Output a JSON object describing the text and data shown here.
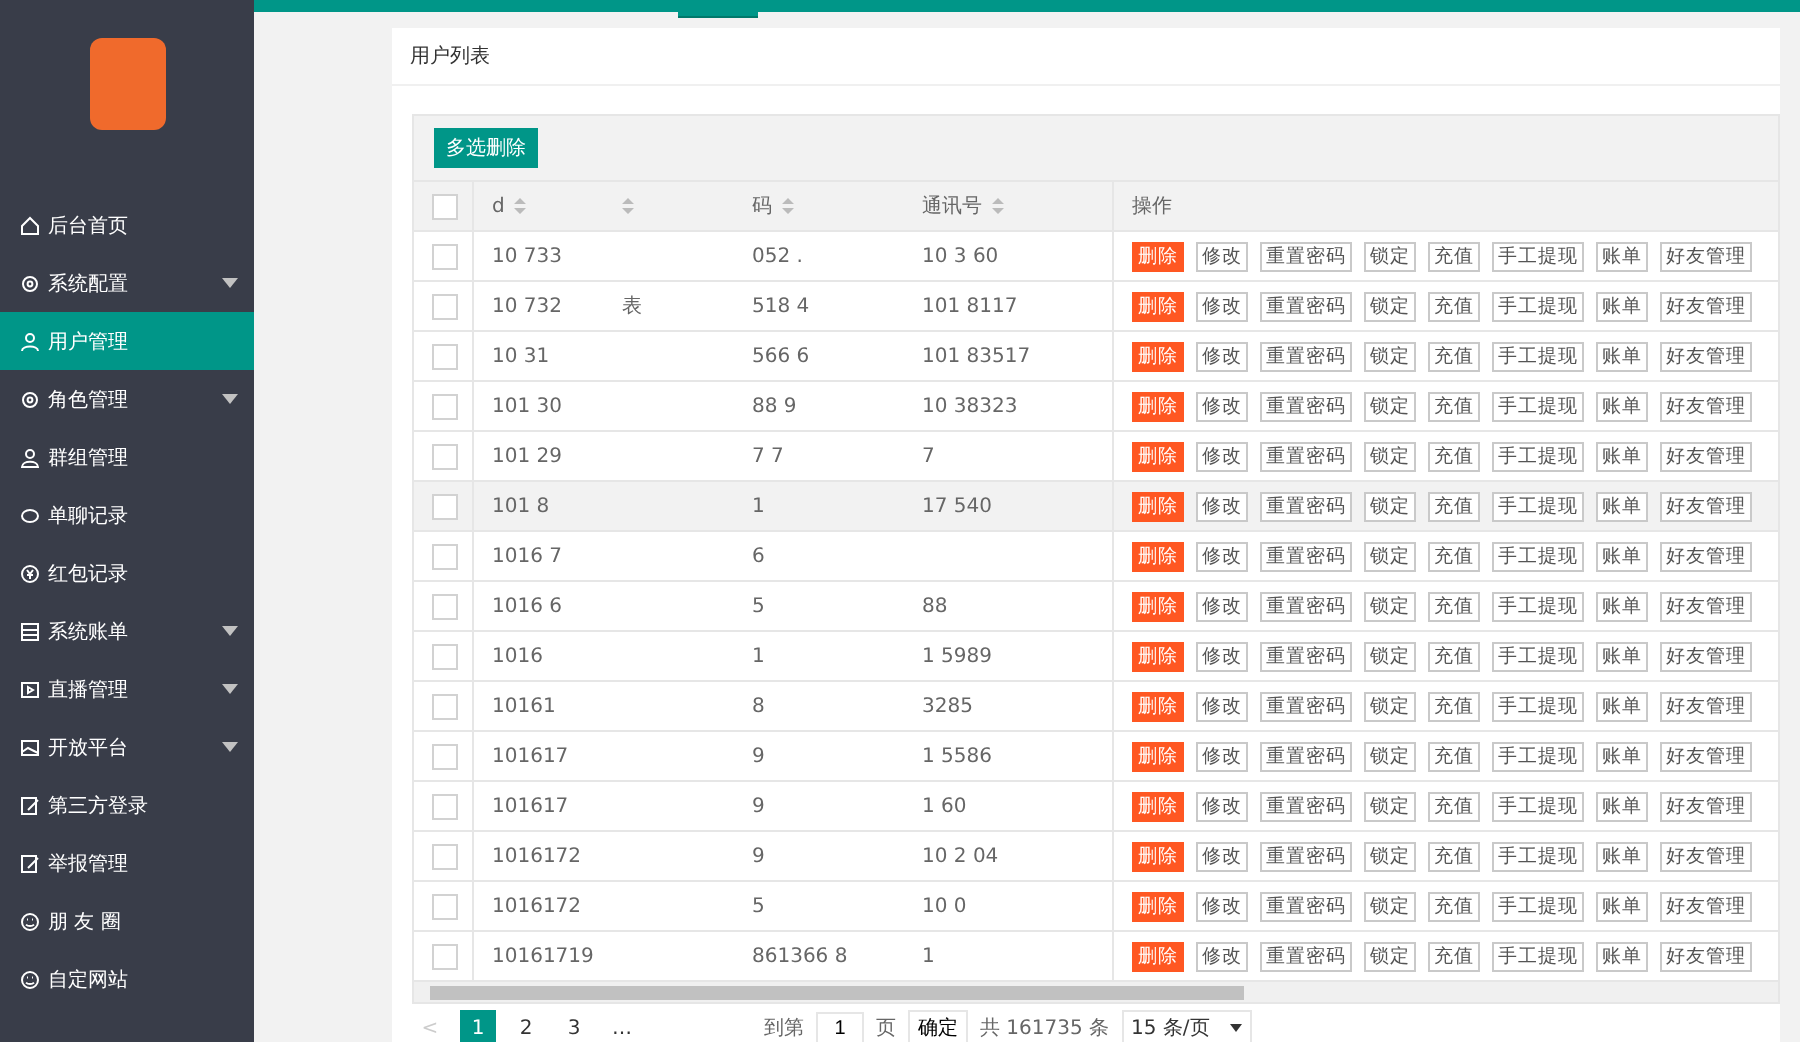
{
  "sidebar": {
    "items": [
      {
        "label": "后台首页",
        "expandable": false,
        "selected": false
      },
      {
        "label": "系统配置",
        "expandable": true,
        "selected": false
      },
      {
        "label": "用户管理",
        "expandable": false,
        "selected": true
      },
      {
        "label": "角色管理",
        "expandable": true,
        "selected": false
      },
      {
        "label": "群组管理",
        "expandable": false,
        "selected": false
      },
      {
        "label": "单聊记录",
        "expandable": false,
        "selected": false
      },
      {
        "label": "红包记录",
        "expandable": false,
        "selected": false
      },
      {
        "label": "系统账单",
        "expandable": true,
        "selected": false
      },
      {
        "label": "直播管理",
        "expandable": true,
        "selected": false
      },
      {
        "label": "开放平台",
        "expandable": true,
        "selected": false
      },
      {
        "label": "第三方登录",
        "expandable": false,
        "selected": false
      },
      {
        "label": "举报管理",
        "expandable": false,
        "selected": false
      },
      {
        "label": "朋 友 圈",
        "expandable": false,
        "selected": false
      },
      {
        "label": "自定网站",
        "expandable": false,
        "selected": false
      }
    ]
  },
  "card": {
    "title": "用户列表",
    "toolbar_button": "多选删除",
    "table": {
      "all_checked": false,
      "columns": [
        "d",
        "",
        "码",
        "通讯号",
        "操作"
      ],
      "rows": [
        {
          "cells": [
            "10 733",
            "",
            "052 .",
            "10 3 60"
          ],
          "checked": false,
          "hovered": false,
          "actions": [
            "删除",
            "修改",
            "重置密码",
            "锁定",
            "充值",
            "手工提现",
            "账单",
            "好友管理"
          ]
        },
        {
          "cells": [
            "10 732",
            "表",
            "518 4",
            "101 8117"
          ],
          "checked": false,
          "hovered": false,
          "actions": [
            "删除",
            "修改",
            "重置密码",
            "锁定",
            "充值",
            "手工提现",
            "账单",
            "好友管理"
          ]
        },
        {
          "cells": [
            "10 31",
            "",
            "566 6",
            "101 83517"
          ],
          "checked": false,
          "hovered": false,
          "actions": [
            "删除",
            "修改",
            "重置密码",
            "锁定",
            "充值",
            "手工提现",
            "账单",
            "好友管理"
          ]
        },
        {
          "cells": [
            "101 30",
            "",
            "88 9",
            "10 38323"
          ],
          "checked": false,
          "hovered": false,
          "actions": [
            "删除",
            "修改",
            "重置密码",
            "锁定",
            "充值",
            "手工提现",
            "账单",
            "好友管理"
          ]
        },
        {
          "cells": [
            "101 29",
            "",
            "7 7",
            "7"
          ],
          "checked": false,
          "hovered": false,
          "actions": [
            "删除",
            "修改",
            "重置密码",
            "锁定",
            "充值",
            "手工提现",
            "账单",
            "好友管理"
          ]
        },
        {
          "cells": [
            "101 8",
            "",
            "1",
            "17 540"
          ],
          "checked": false,
          "hovered": true,
          "actions": [
            "删除",
            "修改",
            "重置密码",
            "锁定",
            "充值",
            "手工提现",
            "账单",
            "好友管理"
          ]
        },
        {
          "cells": [
            "1016 7",
            "",
            "6",
            ""
          ],
          "checked": false,
          "hovered": false,
          "actions": [
            "删除",
            "修改",
            "重置密码",
            "锁定",
            "充值",
            "手工提现",
            "账单",
            "好友管理"
          ]
        },
        {
          "cells": [
            "1016 6",
            "",
            "5",
            "88"
          ],
          "checked": false,
          "hovered": false,
          "actions": [
            "删除",
            "修改",
            "重置密码",
            "锁定",
            "充值",
            "手工提现",
            "账单",
            "好友管理"
          ]
        },
        {
          "cells": [
            "1016",
            "",
            "1",
            "1 5989"
          ],
          "checked": false,
          "hovered": false,
          "actions": [
            "删除",
            "修改",
            "重置密码",
            "锁定",
            "充值",
            "手工提现",
            "账单",
            "好友管理"
          ]
        },
        {
          "cells": [
            "10161",
            "",
            "8",
            "3285"
          ],
          "checked": false,
          "hovered": false,
          "actions": [
            "删除",
            "修改",
            "重置密码",
            "锁定",
            "充值",
            "手工提现",
            "账单",
            "好友管理"
          ]
        },
        {
          "cells": [
            "101617",
            "",
            "9",
            "1 5586"
          ],
          "checked": false,
          "hovered": false,
          "actions": [
            "删除",
            "修改",
            "重置密码",
            "锁定",
            "充值",
            "手工提现",
            "账单",
            "好友管理"
          ]
        },
        {
          "cells": [
            "101617",
            "",
            "9",
            "1 60"
          ],
          "checked": false,
          "hovered": false,
          "actions": [
            "删除",
            "修改",
            "重置密码",
            "锁定",
            "充值",
            "手工提现",
            "账单",
            "好友管理"
          ]
        },
        {
          "cells": [
            "1016172",
            "",
            "9",
            "10 2 04"
          ],
          "checked": false,
          "hovered": false,
          "actions": [
            "删除",
            "修改",
            "重置密码",
            "锁定",
            "充值",
            "手工提现",
            "账单",
            "好友管理"
          ]
        },
        {
          "cells": [
            "1016172",
            "",
            "5",
            "10 0"
          ],
          "checked": false,
          "hovered": false,
          "actions": [
            "删除",
            "修改",
            "重置密码",
            "锁定",
            "充值",
            "手工提现",
            "账单",
            "好友管理"
          ]
        },
        {
          "cells": [
            "10161719",
            "",
            "861366 8",
            "1"
          ],
          "checked": false,
          "hovered": false,
          "actions": [
            "删除",
            "修改",
            "重置密码",
            "锁定",
            "充值",
            "手工提现",
            "账单",
            "好友管理"
          ]
        }
      ]
    },
    "pagination": {
      "prev": "<",
      "pages": [
        {
          "label": "1",
          "selected": true
        },
        {
          "label": "2",
          "selected": false
        },
        {
          "label": "3",
          "selected": false
        },
        {
          "label": "…",
          "selected": false
        }
      ],
      "goto_label": "到第",
      "goto_value": "1",
      "page_unit": "页",
      "confirm": "确定",
      "total": "共 161735 条",
      "page_size": "15 条/页"
    }
  }
}
